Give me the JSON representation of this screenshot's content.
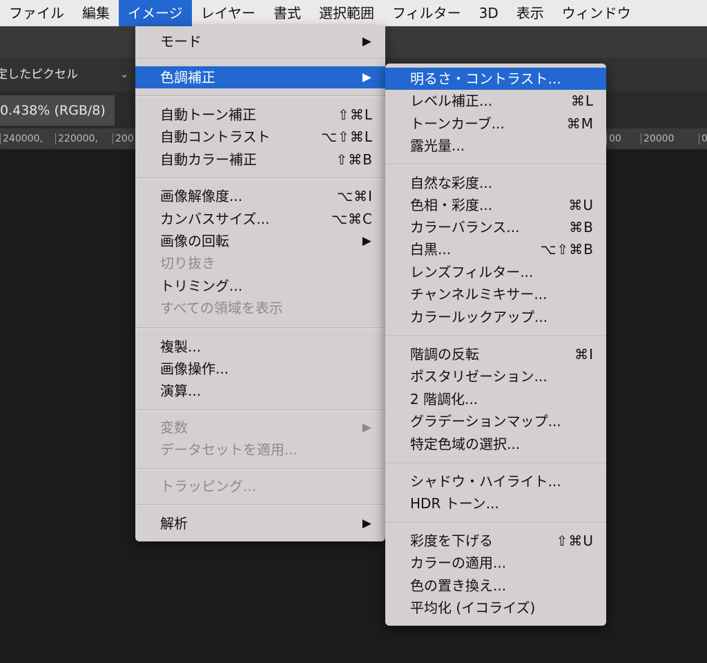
{
  "menubar": {
    "items": [
      {
        "label": "ファイル"
      },
      {
        "label": "編集"
      },
      {
        "label": "イメージ"
      },
      {
        "label": "レイヤー"
      },
      {
        "label": "書式"
      },
      {
        "label": "選択範囲"
      },
      {
        "label": "フィルター"
      },
      {
        "label": "3D"
      },
      {
        "label": "表示"
      },
      {
        "label": "ウィンドウ"
      }
    ]
  },
  "options": {
    "select_value": "定したピクセル"
  },
  "document": {
    "tab_label": "0.438% (RGB/8)",
    "ruler_labels": [
      "240000,",
      "220000,",
      "200",
      "00",
      "20000",
      "0"
    ]
  },
  "image_menu": {
    "items": [
      {
        "label": "モード",
        "shortcut": "",
        "submenu": true
      },
      {
        "label": "色調補正",
        "shortcut": "",
        "submenu": true
      },
      {
        "label": "自動トーン補正",
        "shortcut": "⇧⌘L"
      },
      {
        "label": "自動コントラスト",
        "shortcut": "⌥⇧⌘L"
      },
      {
        "label": "自動カラー補正",
        "shortcut": "⇧⌘B"
      },
      {
        "label": "画像解像度...",
        "shortcut": "⌥⌘I"
      },
      {
        "label": "カンバスサイズ...",
        "shortcut": "⌥⌘C"
      },
      {
        "label": "画像の回転",
        "shortcut": "",
        "submenu": true
      },
      {
        "label": "切り抜き",
        "shortcut": ""
      },
      {
        "label": "トリミング...",
        "shortcut": ""
      },
      {
        "label": "すべての領域を表示",
        "shortcut": ""
      },
      {
        "label": "複製...",
        "shortcut": ""
      },
      {
        "label": "画像操作...",
        "shortcut": ""
      },
      {
        "label": "演算...",
        "shortcut": ""
      },
      {
        "label": "変数",
        "shortcut": "",
        "submenu": true
      },
      {
        "label": "データセットを適用...",
        "shortcut": ""
      },
      {
        "label": "トラッピング...",
        "shortcut": ""
      },
      {
        "label": "解析",
        "shortcut": "",
        "submenu": true
      }
    ],
    "submenu_arrow": "▶"
  },
  "adjustments_menu": {
    "items": [
      {
        "label": "明るさ・コントラスト...",
        "shortcut": ""
      },
      {
        "label": "レベル補正...",
        "shortcut": "⌘L"
      },
      {
        "label": "トーンカーブ...",
        "shortcut": "⌘M"
      },
      {
        "label": "露光量...",
        "shortcut": ""
      },
      {
        "label": "自然な彩度...",
        "shortcut": ""
      },
      {
        "label": "色相・彩度...",
        "shortcut": "⌘U"
      },
      {
        "label": "カラーバランス...",
        "shortcut": "⌘B"
      },
      {
        "label": "白黒...",
        "shortcut": "⌥⇧⌘B"
      },
      {
        "label": "レンズフィルター...",
        "shortcut": ""
      },
      {
        "label": "チャンネルミキサー...",
        "shortcut": ""
      },
      {
        "label": "カラールックアップ...",
        "shortcut": ""
      },
      {
        "label": "階調の反転",
        "shortcut": "⌘I"
      },
      {
        "label": "ポスタリゼーション...",
        "shortcut": ""
      },
      {
        "label": "2 階調化...",
        "shortcut": ""
      },
      {
        "label": "グラデーションマップ...",
        "shortcut": ""
      },
      {
        "label": "特定色域の選択...",
        "shortcut": ""
      },
      {
        "label": "シャドウ・ハイライト...",
        "shortcut": ""
      },
      {
        "label": "HDR トーン...",
        "shortcut": ""
      },
      {
        "label": "彩度を下げる",
        "shortcut": "⇧⌘U"
      },
      {
        "label": "カラーの適用...",
        "shortcut": ""
      },
      {
        "label": "色の置き換え...",
        "shortcut": ""
      },
      {
        "label": "平均化 (イコライズ)",
        "shortcut": ""
      }
    ]
  }
}
